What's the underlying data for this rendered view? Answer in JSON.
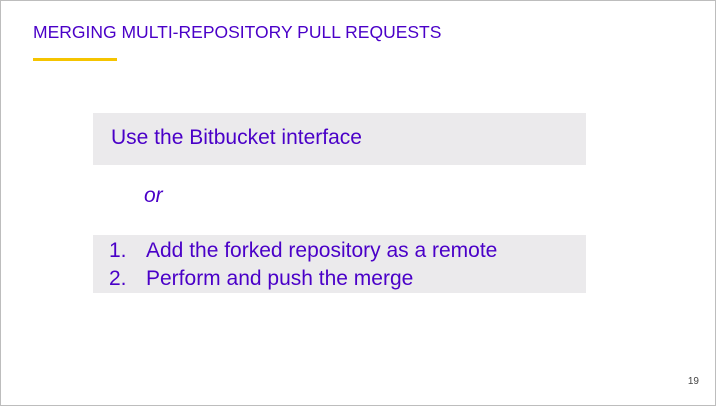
{
  "slide": {
    "title": "MERGING MULTI-REPOSITORY PULL REQUESTS",
    "option_1": "Use the Bitbucket interface",
    "separator": "or",
    "steps": [
      {
        "number": "1.",
        "text": "Add the forked repository as a remote"
      },
      {
        "number": "2.",
        "text": "Perform and push the merge"
      }
    ],
    "page_number": "19"
  },
  "colors": {
    "title_text": "#4a00c8",
    "accent_underline": "#f5c400",
    "box_background": "#ebeaec"
  }
}
